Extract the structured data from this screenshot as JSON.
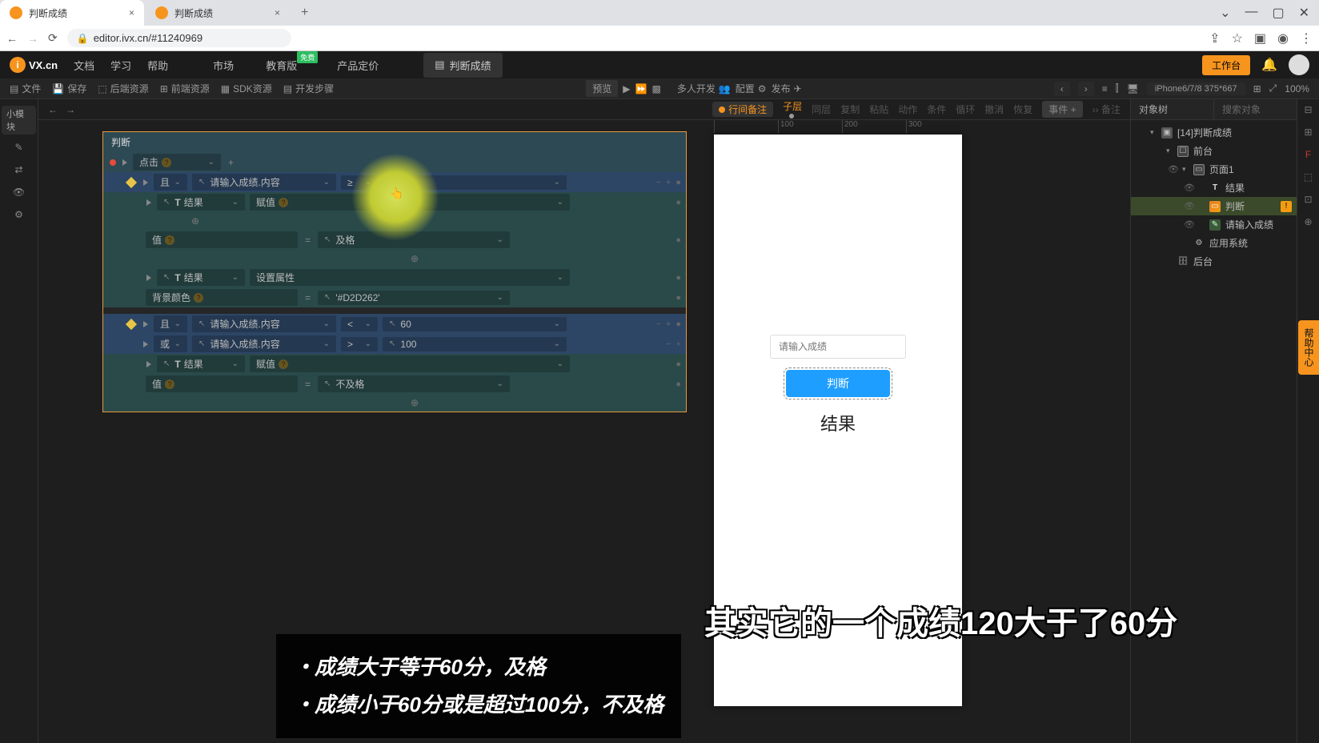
{
  "browser": {
    "tabs": [
      {
        "title": "判断成绩"
      },
      {
        "title": "判断成绩"
      }
    ],
    "url": "editor.ivx.cn/#11240969"
  },
  "topnav": {
    "brand": "VX.cn",
    "menu": {
      "docs": "文档",
      "learn": "学习",
      "help": "帮助",
      "market": "市场",
      "edu": "教育版",
      "edu_badge": "免费",
      "pricing": "产品定价"
    },
    "app_tab": "判断成绩",
    "workbench": "工作台"
  },
  "secbar": {
    "file": "文件",
    "save": "保存",
    "backend": "后端资源",
    "frontend": "前端资源",
    "sdk": "SDK资源",
    "steps": "开发步骤",
    "preview": "预览",
    "multi": "多人开发",
    "config": "配置",
    "publish": "发布",
    "device": "iPhone6/7/8 375*667",
    "zoom": "100%"
  },
  "centertop": {
    "row_note": "行间备注",
    "sub": "子层",
    "same": "同层",
    "copy": "复制",
    "paste": "粘贴",
    "action": "动作",
    "cond": "条件",
    "loop": "循环",
    "undo": "撤消",
    "redo": "恢复",
    "events": "事件",
    "remark": "备注"
  },
  "logic": {
    "panel_title": "判断",
    "click_label": "点击",
    "if_label": "且",
    "or_label": "或",
    "input_field": "请输入成绩.内容",
    "op_ge": "≥",
    "op_lt": "<",
    "op_gt": ">",
    "val60": "60",
    "val100": "100",
    "target_result": "结果",
    "action_assign": "赋值",
    "action_setattr": "设置属性",
    "prop_value": "值",
    "prop_bgcolor": "背景颜色",
    "pass_text": "及格",
    "fail_text": "不及格",
    "color_val": "'#D2D262'"
  },
  "phone": {
    "placeholder": "请输入成绩",
    "button": "判断",
    "result": "结果",
    "ruler": [
      "",
      "100",
      "200",
      "300"
    ]
  },
  "tree": {
    "header": "对象树",
    "search": "搜索对象",
    "root": "[14]判断成绩",
    "front": "前台",
    "page": "页面1",
    "result_node": "结果",
    "judge_node": "判断",
    "input_node": "请输入成绩",
    "sys": "应用系统",
    "back": "后台"
  },
  "subtitle1_l1": "・成绩大于等于60分，及格",
  "subtitle1_l2": "・成绩小于60分或是超过100分，不及格",
  "subtitle2": "其实它的一个成绩120大于了60分",
  "help_tab": "帮助中心",
  "small_module": "小模块"
}
